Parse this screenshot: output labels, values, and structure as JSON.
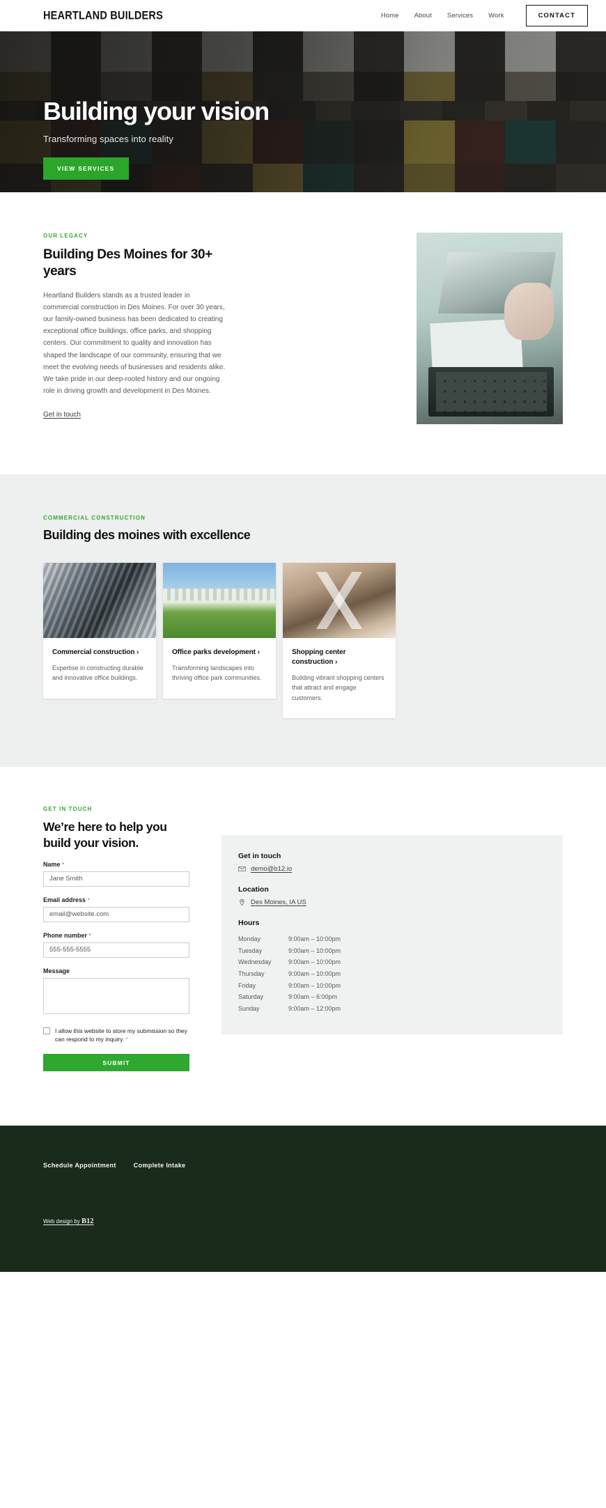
{
  "header": {
    "brand": "HEARTLAND BUILDERS",
    "nav": [
      {
        "label": "Home"
      },
      {
        "label": "About"
      },
      {
        "label": "Services"
      },
      {
        "label": "Work"
      }
    ],
    "contact_label": "CONTACT"
  },
  "hero": {
    "title": "Building your vision",
    "subtitle": "Transforming spaces into reality",
    "cta_label": "VIEW SERVICES"
  },
  "legacy": {
    "eyebrow": "OUR LEGACY",
    "title": "Building Des Moines for 30+ years",
    "body": "Heartland Builders stands as a trusted leader in commercial construction in Des Moines. For over 30 years, our family-owned business has been dedicated to creating exceptional office buildings, office parks, and shopping centers. Our commitment to quality and innovation has shaped the landscape of our community, ensuring that we meet the evolving needs of businesses and residents alike. We take pride in our deep-rooted history and our ongoing role in driving growth and development in Des Moines.",
    "link": "Get in touch"
  },
  "services": {
    "eyebrow": "COMMERCIAL CONSTRUCTION",
    "title": "Building des moines with excellence",
    "cards": [
      {
        "title": "Commercial construction",
        "chevron": "›",
        "desc": "Expertise in constructing durable and innovative office buildings."
      },
      {
        "title": "Office parks development",
        "chevron": "›",
        "desc": "Transforming landscapes into thriving office park communities."
      },
      {
        "title": "Shopping center construction",
        "chevron": "›",
        "desc": "Building vibrant shopping centers that attract and engage customers."
      }
    ]
  },
  "contact": {
    "eyebrow": "GET IN TOUCH",
    "title": "We’re here to help you build your vision.",
    "fields": {
      "name_label": "Name",
      "name_placeholder": "Jane Smith",
      "email_label": "Email address",
      "email_placeholder": "email@website.com",
      "phone_label": "Phone number",
      "phone_placeholder": "555-555-5555",
      "message_label": "Message",
      "message_value": ""
    },
    "consent": "I allow this website to store my submission so they can respond to my inquiry.",
    "required_mark": "*",
    "submit_label": "SUBMIT",
    "info": {
      "get_in_touch_heading": "Get in touch",
      "email": "demo@b12.io",
      "location_heading": "Location",
      "location": "Des Moines, IA US",
      "hours_heading": "Hours",
      "hours": [
        {
          "day": "Monday",
          "time": "9:00am  –  10:00pm"
        },
        {
          "day": "Tuesday",
          "time": "9:00am  –  10:00pm"
        },
        {
          "day": "Wednesday",
          "time": "9:00am  –  10:00pm"
        },
        {
          "day": "Thursday",
          "time": "9:00am  –  10:00pm"
        },
        {
          "day": "Friday",
          "time": "9:00am  –  10:00pm"
        },
        {
          "day": "Saturday",
          "time": "9:00am  –  6:00pm"
        },
        {
          "day": "Sunday",
          "time": "9:00am  –  12:00pm"
        }
      ]
    }
  },
  "footer": {
    "links": [
      {
        "label": "Schedule Appointment"
      },
      {
        "label": "Complete Intake"
      }
    ],
    "credit_prefix": "Web design by ",
    "credit_brand": "B12"
  },
  "colors": {
    "accent_green": "#2ba62b",
    "eyebrow_green": "#2eaa2e",
    "required_orange": "#e08a3c",
    "footer_green": "#1b2b1b",
    "panel_gray": "#f0f1f1",
    "section_gray": "#eeefef"
  }
}
